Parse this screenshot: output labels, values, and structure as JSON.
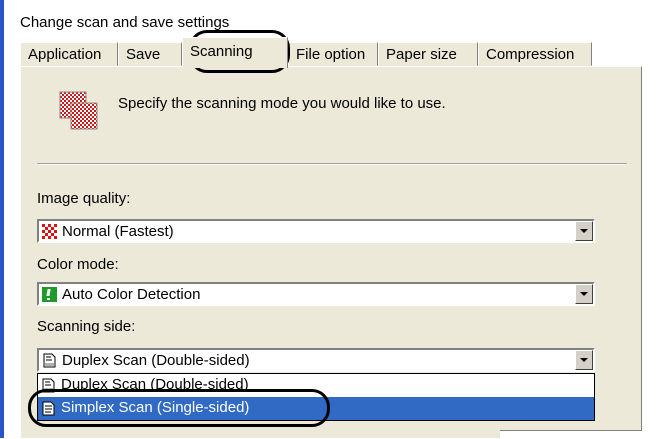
{
  "section_title": "Change scan and save settings",
  "tabs": [
    {
      "label": "Application"
    },
    {
      "label": "Save"
    },
    {
      "label": "Scanning"
    },
    {
      "label": "File option"
    },
    {
      "label": "Paper size"
    },
    {
      "label": "Compression"
    }
  ],
  "active_tab": "Scanning",
  "instruction": "Specify the scanning mode you would like to use.",
  "image_quality": {
    "label": "Image quality:",
    "value": "Normal (Fastest)",
    "icon": "checker-red-icon"
  },
  "color_mode": {
    "label": "Color mode:",
    "value": "Auto Color Detection",
    "icon": "auto-color-icon"
  },
  "scanning_side": {
    "label": "Scanning side:",
    "value": "Duplex Scan (Double-sided)",
    "icon": "duplex-page-icon",
    "options": [
      {
        "label": "Duplex Scan (Double-sided)",
        "icon": "duplex-page-icon"
      },
      {
        "label": "Simplex Scan (Single-sided)",
        "icon": "simplex-page-icon"
      }
    ],
    "highlighted_option": "Simplex Scan (Single-sided)"
  },
  "colors": {
    "accent": "#2a55c8",
    "selection": "#316ac5",
    "panel": "#ece9d8"
  }
}
